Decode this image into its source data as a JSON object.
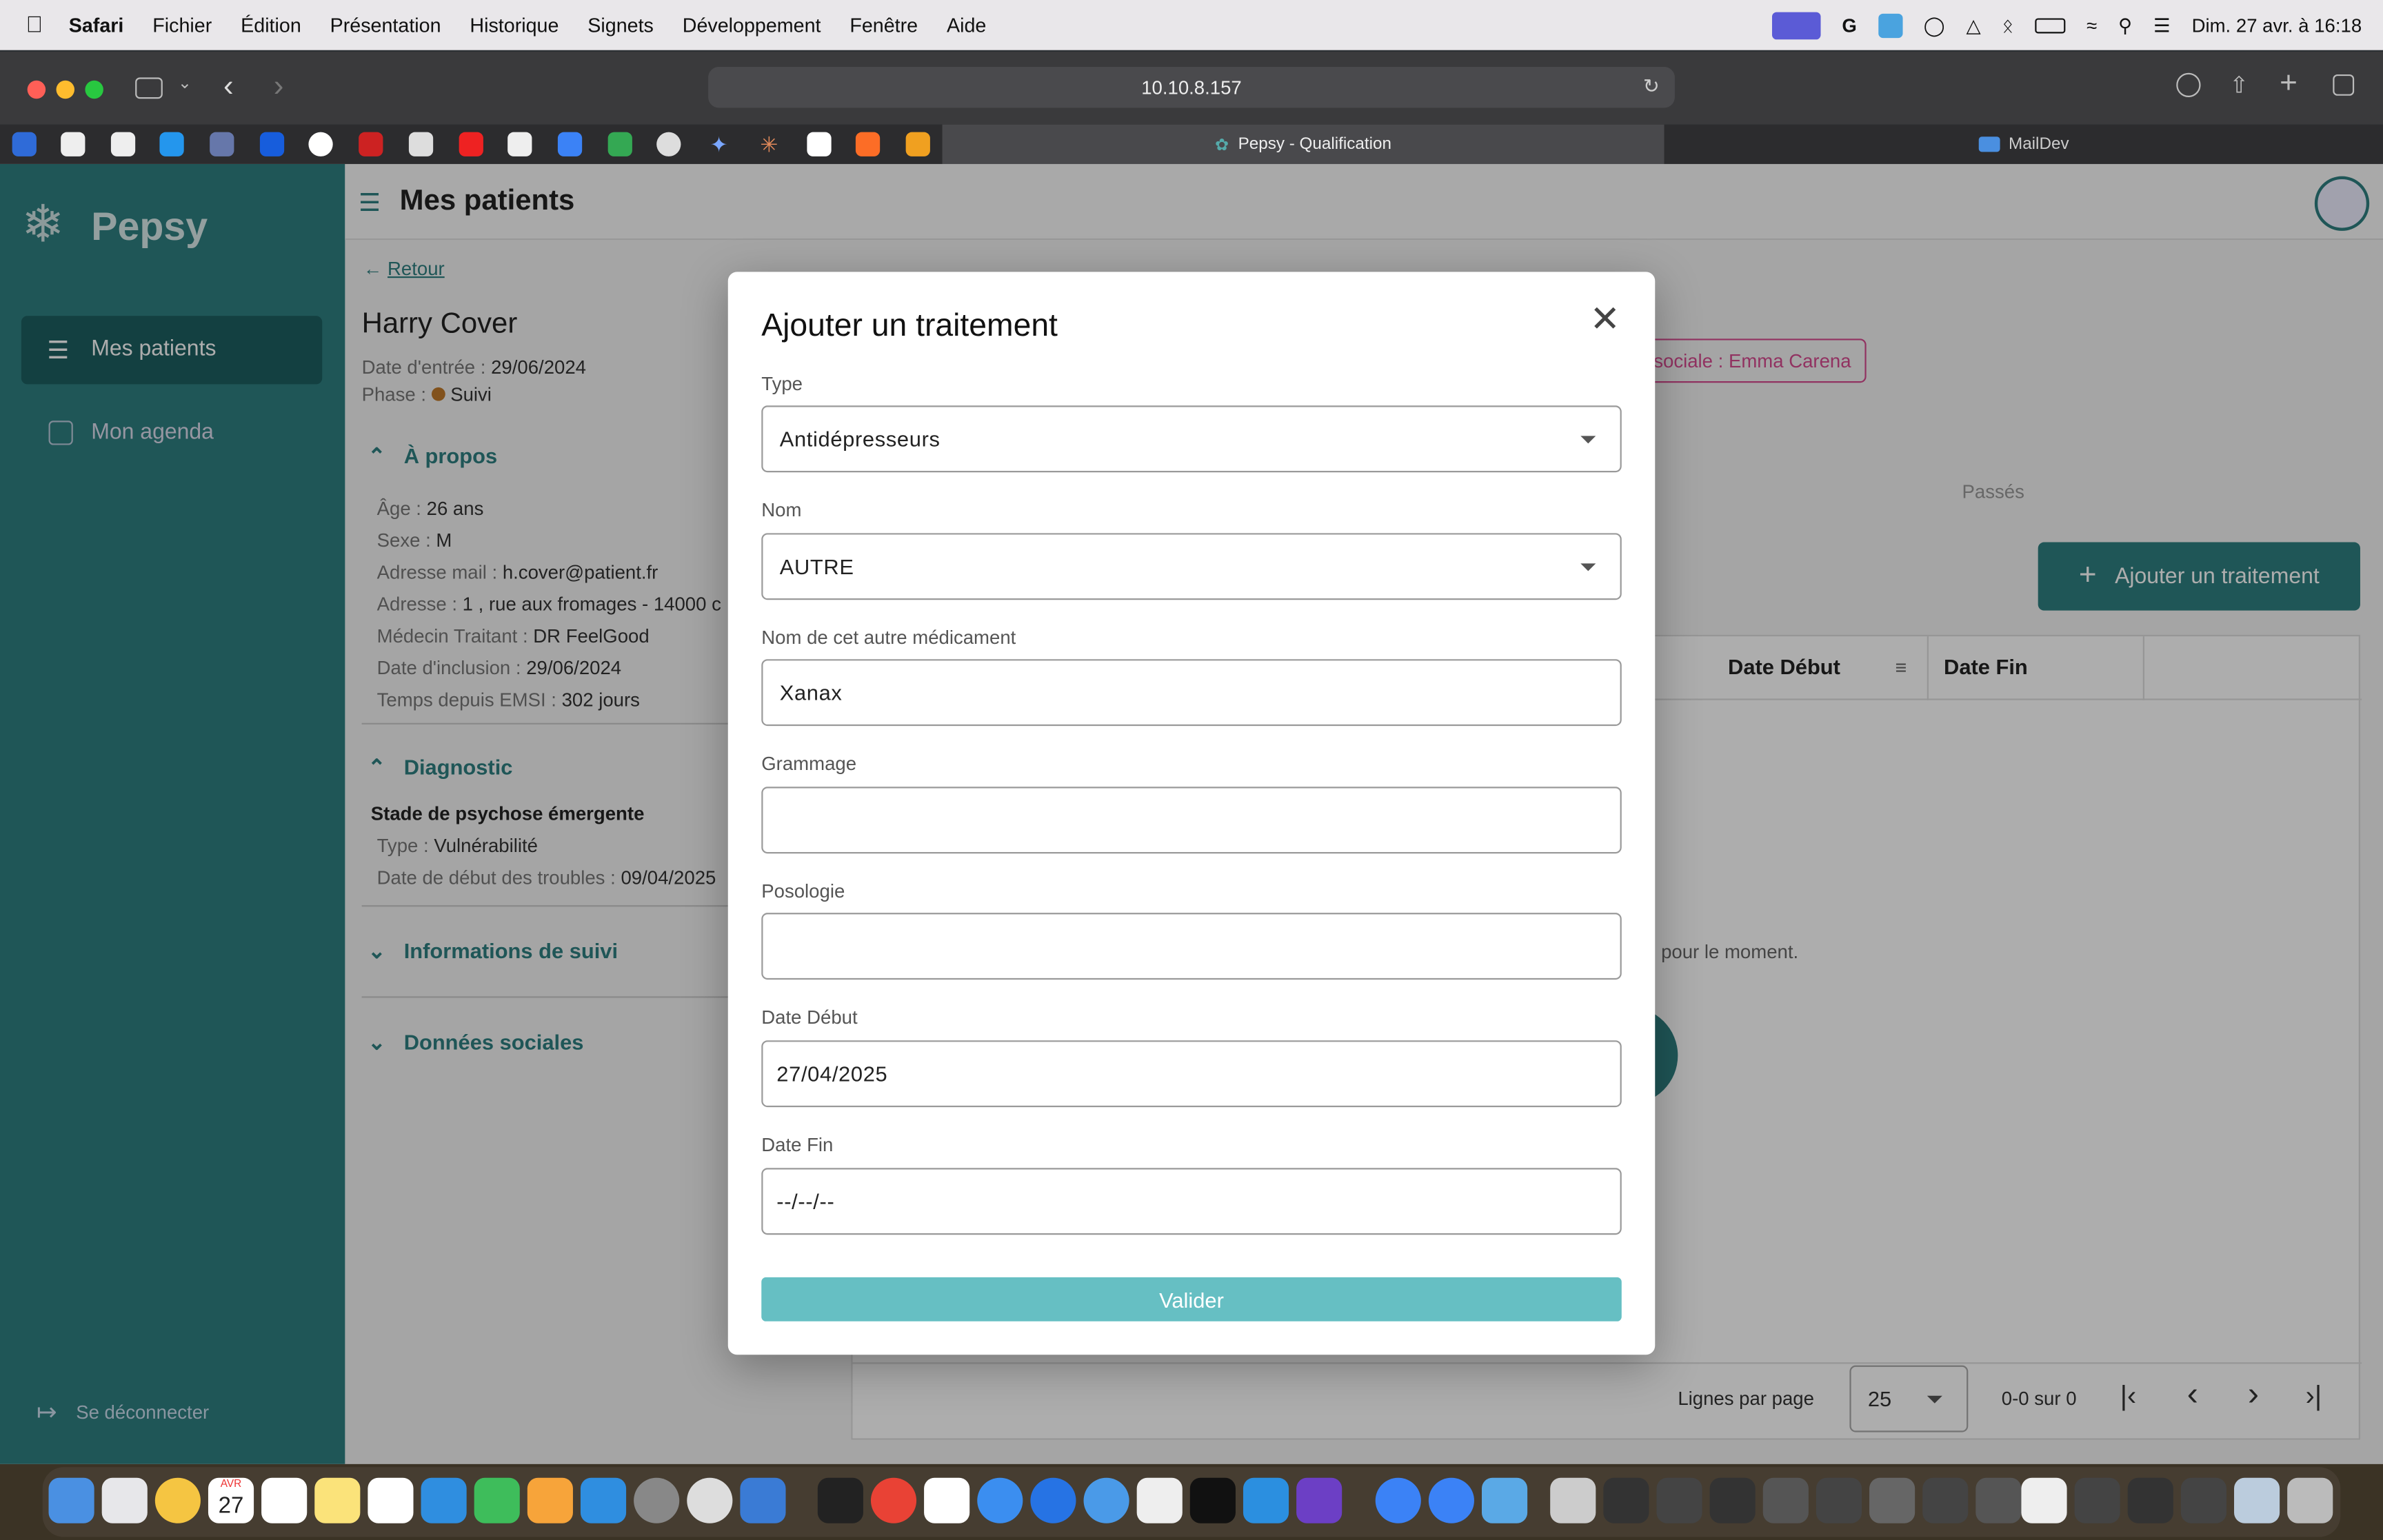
{
  "menubar": {
    "app": "Safari",
    "items": [
      "Fichier",
      "Édition",
      "Présentation",
      "Historique",
      "Signets",
      "Développement",
      "Fenêtre",
      "Aide"
    ],
    "datetime": "Dim. 27 avr. à 16:18"
  },
  "browser": {
    "url": "10.10.8.157",
    "tabs": [
      {
        "label": "Pepsy - Qualification",
        "active": true
      },
      {
        "label": "MailDev",
        "active": false
      }
    ]
  },
  "sidebar": {
    "logo": "Pepsy",
    "items": [
      {
        "label": "Mes patients",
        "icon": "patients-icon",
        "active": true
      },
      {
        "label": "Mon agenda",
        "icon": "calendar-icon",
        "active": false
      }
    ],
    "logout": "Se déconnecter"
  },
  "header": {
    "title": "Mes patients"
  },
  "patient": {
    "back": "Retour",
    "name": "Harry Cover",
    "entry_label": "Date d'entrée : ",
    "entry_value": "29/06/2024",
    "phase_label": "Phase : ",
    "phase_value": "Suivi",
    "about_title": "À propos",
    "about": [
      {
        "label": "Âge : ",
        "value": "26 ans"
      },
      {
        "label": "Sexe : ",
        "value": "M"
      },
      {
        "label": "Adresse mail : ",
        "value": "h.cover@patient.fr"
      },
      {
        "label": "Adresse : ",
        "value": "1 , rue aux fromages - 14000 c"
      },
      {
        "label": "Médecin Traitant : ",
        "value": "DR FeelGood"
      },
      {
        "label": "Date d'inclusion : ",
        "value": "29/06/2024"
      },
      {
        "label": "Temps depuis EMSI : ",
        "value": "302 jours"
      }
    ],
    "diag_title": "Diagnostic",
    "diag_stage": "Stade de psychose émergente",
    "diag_type_label": "Type : ",
    "diag_type_value": "Vulnérabilité",
    "diag_date_label": "Date de début des troubles : ",
    "diag_date_value": "09/04/2025",
    "suivi_title": "Informations de suivi",
    "social_title": "Données sociales"
  },
  "right": {
    "tag": "sociale : Emma Carena",
    "tab_passes": "Passés",
    "add_button": "Ajouter un traitement",
    "col_date_debut": "Date Début",
    "col_date_fin": "Date Fin",
    "empty": "pour le moment.",
    "rows_label": "Lignes par page",
    "rows_value": "25",
    "range": "0-0 sur 0"
  },
  "modal": {
    "title": "Ajouter un traitement",
    "type_label": "Type",
    "type_value": "Antidépresseurs",
    "nom_label": "Nom",
    "nom_value": "AUTRE",
    "autre_label": "Nom de cet autre médicament",
    "autre_value": "Xanax",
    "grammage_label": "Grammage",
    "grammage_value": "",
    "posologie_label": "Posologie",
    "posologie_value": "",
    "date_debut_label": "Date Début",
    "date_debut_value": "27/04/2025",
    "date_fin_label": "Date Fin",
    "date_fin_value": "--/--/--",
    "submit": "Valider"
  },
  "dock": {
    "calendar_day": "27",
    "calendar_month": "AVR"
  },
  "colors": {
    "primary": "#2e7f81",
    "button": "#66bfc3",
    "tag": "#d64a8f"
  }
}
